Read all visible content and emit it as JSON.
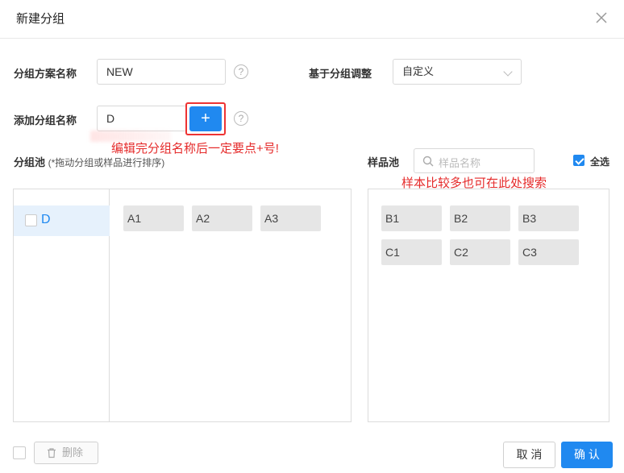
{
  "dialog": {
    "title": "新建分组"
  },
  "form": {
    "scheme_name_label": "分组方案名称",
    "scheme_name_value": "NEW",
    "adjust_label": "基于分组调整",
    "adjust_value": "自定义",
    "add_group_label": "添加分组名称",
    "add_group_value": "D",
    "add_button_label": "+",
    "help_glyph": "?"
  },
  "annotations": {
    "add_note": "编辑完分组名称后一定要点+号!",
    "search_note": "样本比较多也可在此处搜索"
  },
  "group_pool": {
    "title": "分组池",
    "hint": "(*拖动分组或样品进行排序)",
    "groups": [
      {
        "name": "D",
        "checked": false
      }
    ],
    "samples": [
      "A1",
      "A2",
      "A3"
    ]
  },
  "sample_pool": {
    "title": "样品池",
    "search_placeholder": "样品名称",
    "select_all_label": "全选",
    "select_all_checked": true,
    "samples": [
      "B1",
      "B2",
      "B3",
      "C1",
      "C2",
      "C3"
    ]
  },
  "footer": {
    "delete_label": "删除",
    "cancel_label": "取 消",
    "confirm_label": "确 认"
  },
  "colors": {
    "accent": "#2089f0",
    "annotation": "#e52a2a"
  }
}
